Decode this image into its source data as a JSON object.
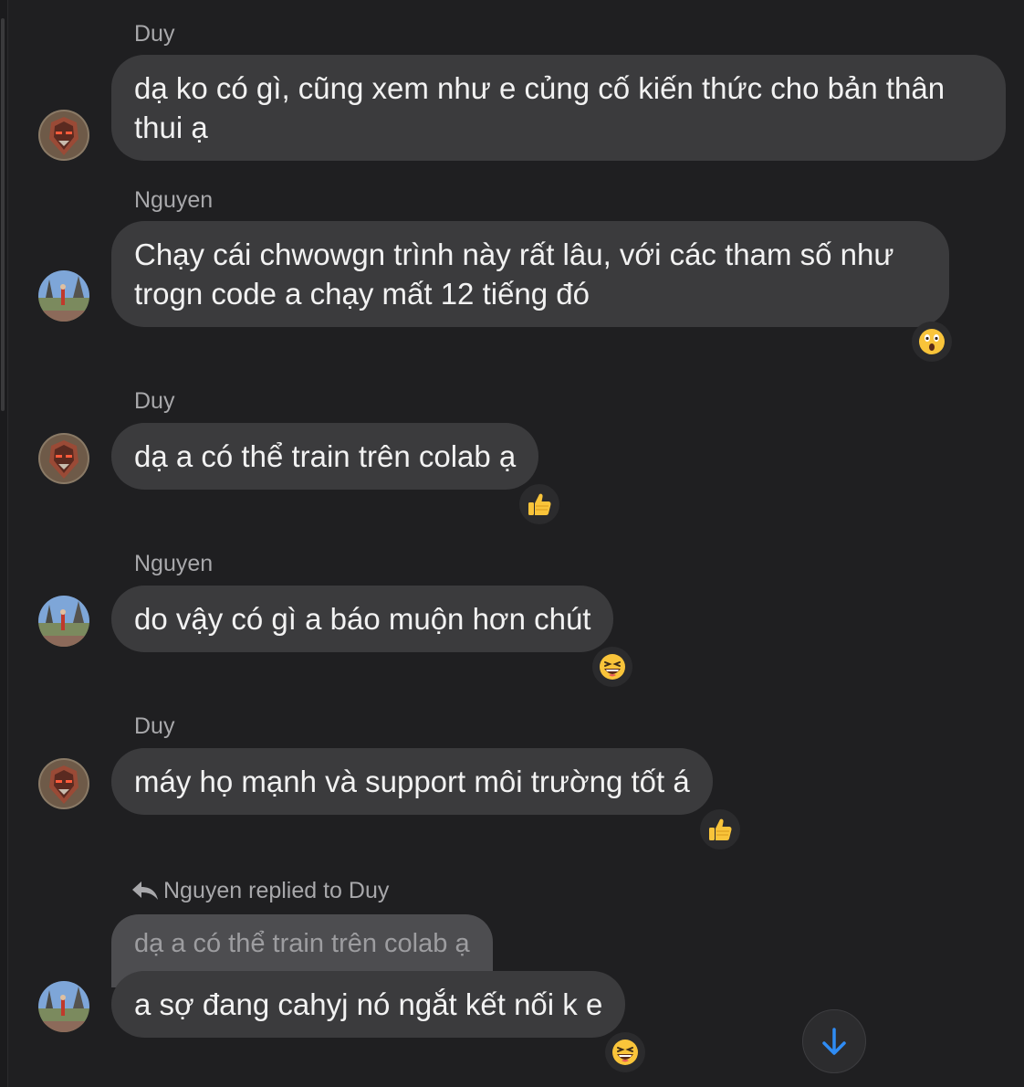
{
  "messages": [
    {
      "sender": "Duy",
      "text": "dạ ko có gì, cũng xem như e củng cố kiến thức cho bản thân thui ạ",
      "avatar": "robot-avatar"
    },
    {
      "sender": "Nguyen",
      "text": "Chạy cái chwowgn trình này rất lâu, với các tham số như trogn code a chạy mất 12 tiếng đó",
      "avatar": "park-avatar",
      "reaction": "astonished-face"
    },
    {
      "sender": "Duy",
      "text": "dạ a có thể train trên colab ạ",
      "avatar": "robot-avatar",
      "reaction": "thumbs-up"
    },
    {
      "sender": "Nguyen",
      "text": "do vậy có gì a báo muộn hơn chút",
      "avatar": "park-avatar",
      "reaction": "laughing-face"
    },
    {
      "sender": "Duy",
      "text": "máy họ mạnh và support môi trường tốt á",
      "avatar": "robot-avatar",
      "reaction": "thumbs-up"
    },
    {
      "reply_label": "Nguyen replied to Duy",
      "quoted_text": "dạ a có thể train trên colab ạ",
      "text": "a sợ đang cahyj nó ngắt kết nối k e",
      "avatar": "park-avatar",
      "reaction": "laughing-face"
    }
  ],
  "icons": {
    "scroll_down": "arrow-down-icon",
    "reply": "reply-arrow-icon"
  },
  "colors": {
    "background": "#1f1f21",
    "bubble": "#3b3b3d",
    "quoted_bubble": "#4d4d50",
    "text": "#f2f2f2",
    "sender": "#a8a8ab",
    "accent": "#2f8cf4",
    "reaction_emoji": "#f9c43a"
  }
}
